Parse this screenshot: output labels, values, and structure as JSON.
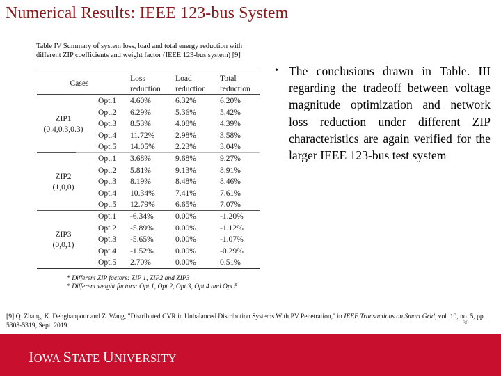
{
  "slide": {
    "title": "Numerical Results: IEEE 123-bus System",
    "page_number": "30"
  },
  "table": {
    "caption": "Table IV Summary of system loss, load and total energy reduction with different ZIP coefficients and weight factor (IEEE 123-bus system) [9]",
    "headers": {
      "cases": "Cases",
      "loss": [
        "Loss",
        "reduction"
      ],
      "load": [
        "Load",
        "reduction"
      ],
      "total": [
        "Total",
        "reduction"
      ]
    },
    "groups": [
      {
        "name": "ZIP1",
        "coefficients": "(0.4,0.3,0.3)",
        "rows": [
          {
            "opt": "Opt.1",
            "loss": "4.60%",
            "load": "6.32%",
            "total": "6.20%"
          },
          {
            "opt": "Opt.2",
            "loss": "6.29%",
            "load": "5.36%",
            "total": "5.42%"
          },
          {
            "opt": "Opt.3",
            "loss": "8.53%",
            "load": "4.08%",
            "total": "4.39%"
          },
          {
            "opt": "Opt.4",
            "loss": "11.72%",
            "load": "2.98%",
            "total": "3.58%"
          },
          {
            "opt": "Opt.5",
            "loss": "14.05%",
            "load": "2.23%",
            "total": "3.04%"
          }
        ]
      },
      {
        "name": "ZIP2",
        "coefficients": "(1,0,0)",
        "rows": [
          {
            "opt": "Opt.1",
            "loss": "3.68%",
            "load": "9.68%",
            "total": "9.27%"
          },
          {
            "opt": "Opt.2",
            "loss": "5.81%",
            "load": "9.13%",
            "total": "8.91%"
          },
          {
            "opt": "Opt.3",
            "loss": "8.19%",
            "load": "8.48%",
            "total": "8.46%"
          },
          {
            "opt": "Opt.4",
            "loss": "10.34%",
            "load": "7.41%",
            "total": "7.61%"
          },
          {
            "opt": "Opt.5",
            "loss": "12.79%",
            "load": "6.65%",
            "total": "7.07%"
          }
        ]
      },
      {
        "name": "ZIP3",
        "coefficients": "(0,0,1)",
        "rows": [
          {
            "opt": "Opt.1",
            "loss": "-6.34%",
            "load": "0.00%",
            "total": "-1.20%"
          },
          {
            "opt": "Opt.2",
            "loss": "-5.89%",
            "load": "0.00%",
            "total": "-1.12%"
          },
          {
            "opt": "Opt.3",
            "loss": "-5.65%",
            "load": "0.00%",
            "total": "-1.07%"
          },
          {
            "opt": "Opt.4",
            "loss": "-1.52%",
            "load": "0.00%",
            "total": "-0.29%"
          },
          {
            "opt": "Opt.5",
            "loss": "2.70%",
            "load": "0.00%",
            "total": "0.51%"
          }
        ]
      }
    ],
    "footnotes": [
      "* Different ZIP factors: ZIP 1, ZIP2 and ZIP3",
      "* Different weight factors: Opt.1, Opt.2, Opt.3, Opt.4 and Opt.5"
    ]
  },
  "bullets": [
    {
      "symbol": "•",
      "text": "The conclusions drawn in Table. III regarding the tradeoff between voltage magnitude optimization and network loss reduction under different ZIP characteristics are again verified for the larger IEEE 123-bus test system"
    }
  ],
  "reference": {
    "prefix": "[9] Q. Zhang, K. Dehghanpour and Z. Wang, \"Distributed CVR in Unbalanced Distribution Systems With PV Penetration,\" in ",
    "journal": "IEEE Transactions on Smart Grid",
    "suffix": ", vol. 10, no. 5, pp. 5308-5319, Sept. 2019."
  },
  "footer": {
    "university_cap1": "I",
    "university_rest1": "OWA ",
    "university_cap2": "S",
    "university_rest2": "TATE ",
    "university_cap3": "U",
    "university_rest3": "NIVERSITY",
    "brand_color": "#c8102e"
  }
}
